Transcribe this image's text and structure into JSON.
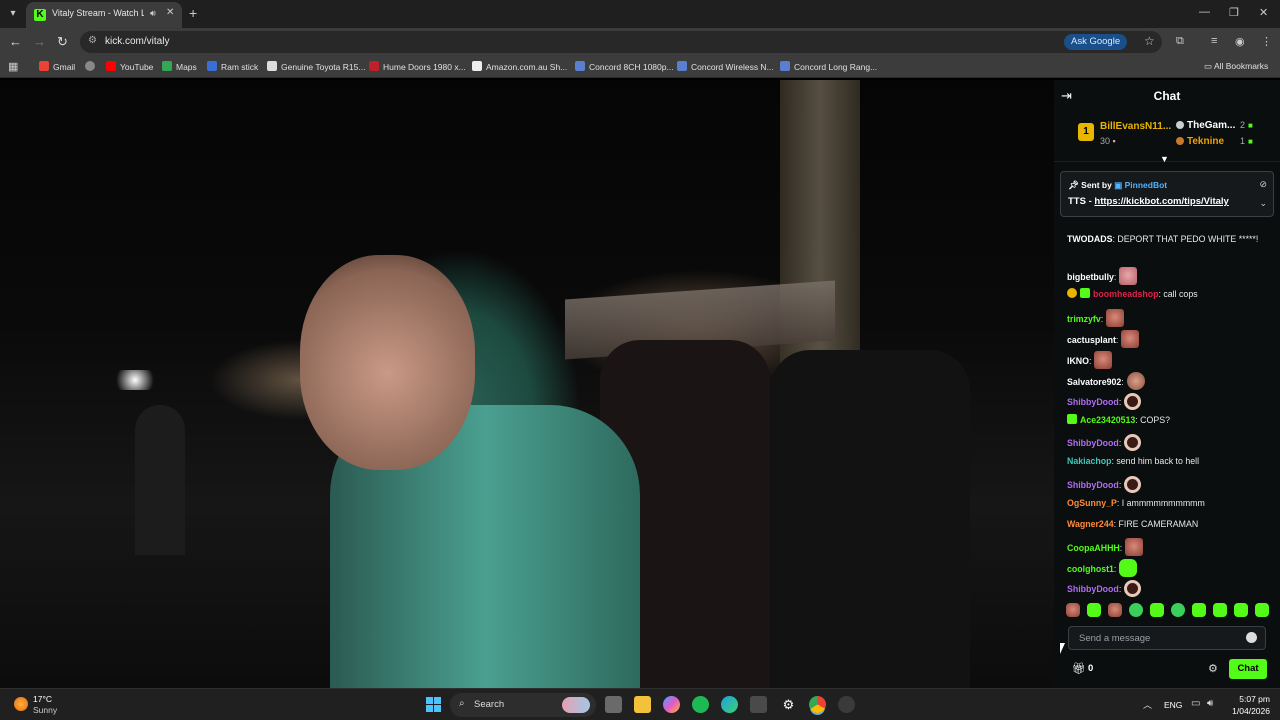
{
  "browser": {
    "tab_title": "Vitaly Stream - Watch Live on Kick",
    "url": "kick.com/vitaly",
    "ask_google": "Ask Google",
    "bookmarks": [
      "Gmail",
      "YouTube",
      "Maps",
      "Ram stick",
      "Genuine Toyota R15...",
      "Hume Doors 1980 x...",
      "Amazon.com.au Sh...",
      "Concord 8CH 1080p...",
      "Concord Wireless N...",
      "Concord Long Rang..."
    ],
    "all_bookmarks": "All Bookmarks"
  },
  "chat": {
    "title": "Chat",
    "leaderboard": {
      "first": {
        "rank": "1",
        "name": "BillEvansN11...",
        "count": "30"
      },
      "second": {
        "name": "TheGam...",
        "count": "2"
      },
      "third": {
        "name": "Teknine",
        "count": "1"
      }
    },
    "pinned": {
      "sent_by": "Sent by",
      "bot": "PinnedBot",
      "prefix": "TTS - ",
      "link": "https://kickbot.com/tips/Vitaly"
    },
    "messages": [
      {
        "user": "TWODADS",
        "color": "#ffffff",
        "text": "DEPORT THAT PEDO WHITE *****!"
      },
      {
        "user": "bigbetbully",
        "color": "#ffffff",
        "text": ""
      },
      {
        "user": "boomheadshop",
        "color": "#e0214b",
        "text": "call cops"
      },
      {
        "user": "trimzyfv",
        "color": "#53fc18",
        "text": ""
      },
      {
        "user": "cactusplant",
        "color": "#ffffff",
        "text": ""
      },
      {
        "user": "IKNO",
        "color": "#ffffff",
        "text": ""
      },
      {
        "user": "Salvatore902",
        "color": "#ffffff",
        "text": ""
      },
      {
        "user": "ShibbyDood",
        "color": "#b06cf0",
        "text": ""
      },
      {
        "user": "Ace23420513",
        "color": "#53fc18",
        "text": "COPS?"
      },
      {
        "user": "ShibbyDood",
        "color": "#b06cf0",
        "text": ""
      },
      {
        "user": "Nakiachop",
        "color": "#3fc7b8",
        "text": "send him back to hell"
      },
      {
        "user": "ShibbyDood",
        "color": "#b06cf0",
        "text": ""
      },
      {
        "user": "OgSunny_P",
        "color": "#ff8a3c",
        "text": "I ammmmmmmmmm"
      },
      {
        "user": "Wagner244",
        "color": "#ff8a3c",
        "text": "FIRE CAMERAMAN"
      },
      {
        "user": "CoopaAHHH",
        "color": "#53fc18",
        "text": ""
      },
      {
        "user": "coolghost1",
        "color": "#53fc18",
        "text": ""
      },
      {
        "user": "ShibbyDood",
        "color": "#b06cf0",
        "text": ""
      }
    ],
    "input_placeholder": "Send a message",
    "points": "0",
    "send_label": "Chat"
  },
  "taskbar": {
    "temperature": "17°C",
    "condition": "Sunny",
    "search_label": "Search",
    "language": "ENG",
    "time": "5:07 pm",
    "date": "1/04/2026"
  },
  "colors": {
    "kick_green": "#53fc18",
    "chat_bg": "#0b0e0f",
    "leader_gold": "#e8b500"
  }
}
